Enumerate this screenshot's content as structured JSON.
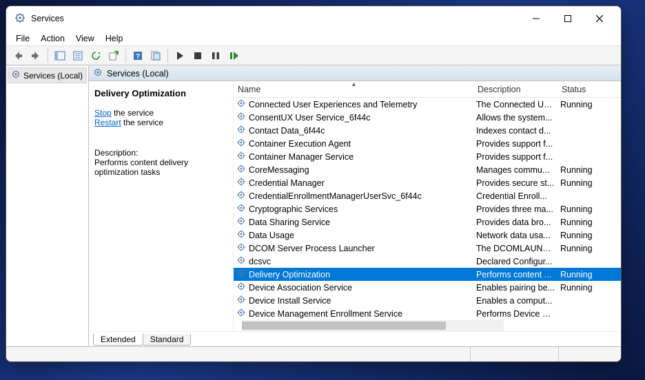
{
  "window": {
    "title": "Services"
  },
  "menus": [
    "File",
    "Action",
    "View",
    "Help"
  ],
  "nav": {
    "root_label": "Services (Local)"
  },
  "content_header": "Services (Local)",
  "selected": {
    "name": "Delivery Optimization",
    "stop_link": "Stop",
    "stop_suffix": " the service",
    "restart_link": "Restart",
    "restart_suffix": " the service",
    "desc_label": "Description:",
    "desc_text": "Performs content delivery optimization tasks"
  },
  "columns": {
    "name": "Name",
    "description": "Description",
    "status": "Status"
  },
  "services": [
    {
      "name": "Connected User Experiences and Telemetry",
      "desc": "The Connected Us...",
      "status": "Running"
    },
    {
      "name": "ConsentUX User Service_6f44c",
      "desc": "Allows the system...",
      "status": ""
    },
    {
      "name": "Contact Data_6f44c",
      "desc": "Indexes contact d...",
      "status": ""
    },
    {
      "name": "Container Execution Agent",
      "desc": "Provides support f...",
      "status": ""
    },
    {
      "name": "Container Manager Service",
      "desc": "Provides support f...",
      "status": ""
    },
    {
      "name": "CoreMessaging",
      "desc": "Manages commu...",
      "status": "Running"
    },
    {
      "name": "Credential Manager",
      "desc": "Provides secure st...",
      "status": "Running"
    },
    {
      "name": "CredentialEnrollmentManagerUserSvc_6f44c",
      "desc": "Credential Enroll...",
      "status": ""
    },
    {
      "name": "Cryptographic Services",
      "desc": "Provides three ma...",
      "status": "Running"
    },
    {
      "name": "Data Sharing Service",
      "desc": "Provides data bro...",
      "status": "Running"
    },
    {
      "name": "Data Usage",
      "desc": "Network data usa...",
      "status": "Running"
    },
    {
      "name": "DCOM Server Process Launcher",
      "desc": "The DCOMLAUNC...",
      "status": "Running"
    },
    {
      "name": "dcsvc",
      "desc": "Declared Configur...",
      "status": ""
    },
    {
      "name": "Delivery Optimization",
      "desc": "Performs content ...",
      "status": "Running",
      "selected": true
    },
    {
      "name": "Device Association Service",
      "desc": "Enables pairing be...",
      "status": "Running"
    },
    {
      "name": "Device Install Service",
      "desc": "Enables a comput...",
      "status": ""
    },
    {
      "name": "Device Management Enrollment Service",
      "desc": "Performs Device E...",
      "status": ""
    }
  ],
  "tabs": {
    "extended": "Extended",
    "standard": "Standard"
  }
}
